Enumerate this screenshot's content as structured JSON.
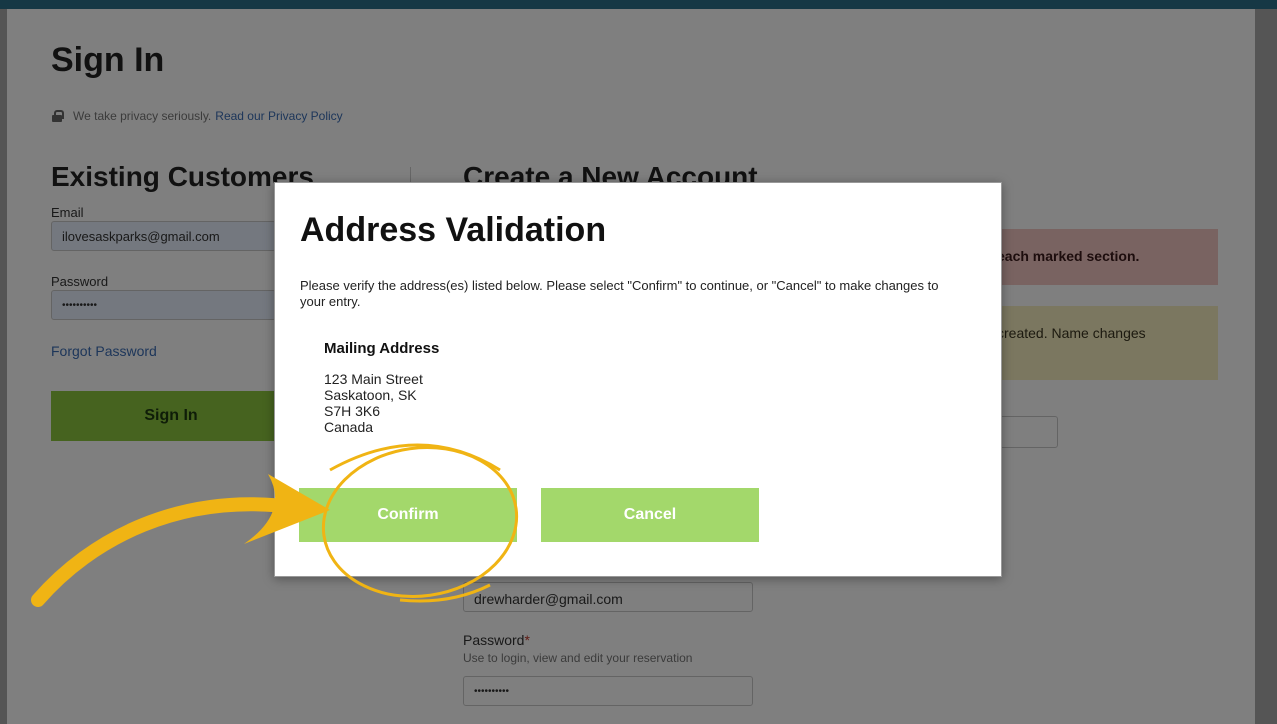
{
  "page": {
    "title": "Sign In",
    "privacy_text": "We take privacy seriously.",
    "privacy_link": "Read our Privacy Policy"
  },
  "existing": {
    "title": "Existing Customers",
    "email_label": "Email",
    "email_value": "ilovesaskparks@gmail.com",
    "password_label": "Password",
    "password_value": "••••••••••",
    "forgot_label": "Forgot Password",
    "signin_label": "Sign In"
  },
  "create": {
    "title": "Create a New Account",
    "alert_red": "each marked section.",
    "alert_yellow": "created. Name changes",
    "email_value": "drewharder@gmail.com",
    "password_label": "Password",
    "password_required": "*",
    "password_help": "Use to login, view and edit your reservation",
    "password_value": "••••••••••"
  },
  "modal": {
    "title": "Address Validation",
    "message": "Please verify the address(es) listed below. Please select \"Confirm\" to continue, or \"Cancel\" to make changes to your entry.",
    "address_heading": "Mailing Address",
    "address_lines": [
      "123 Main Street",
      "Saskatoon, SK",
      "S7H 3K6",
      "Canada"
    ],
    "confirm_label": "Confirm",
    "cancel_label": "Cancel"
  },
  "colors": {
    "header_bar": "#163845",
    "signin_button": "#8cc63f",
    "modal_button": "#a3d86b",
    "annotation": "#f0b414",
    "link": "#3b6db5"
  },
  "icons": [
    "lock-icon"
  ]
}
